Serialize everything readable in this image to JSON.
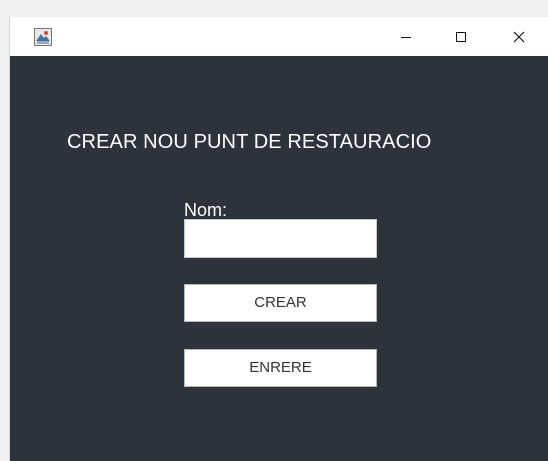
{
  "window": {
    "icon": "java-app-icon",
    "controls": {
      "minimize_icon": "minimize-icon",
      "maximize_icon": "maximize-icon",
      "close_icon": "close-icon"
    }
  },
  "form": {
    "title": "CREAR NOU PUNT DE RESTAURACIO",
    "name_label": "Nom:",
    "name_value": "",
    "create_button": "CREAR",
    "back_button": "ENRERE"
  },
  "colors": {
    "panel_background": "#2c333b",
    "text": "#ffffff"
  }
}
